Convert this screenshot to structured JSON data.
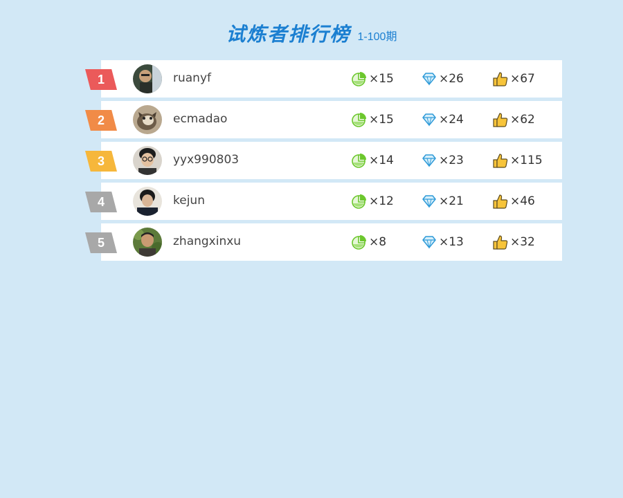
{
  "header": {
    "title": "试炼者排行榜",
    "subtitle": "1-100期"
  },
  "colors": {
    "background": "#d2e8f6",
    "accent": "#1b7fd1",
    "rank_colors": [
      "#eb5a5a",
      "#f18b47",
      "#f6b73b",
      "#a8a8a8",
      "#a8a8a8"
    ]
  },
  "leaderboard": [
    {
      "rank": "1",
      "username": "ruanyf",
      "pie": "×15",
      "diamond": "×26",
      "like": "×67"
    },
    {
      "rank": "2",
      "username": "ecmadao",
      "pie": "×15",
      "diamond": "×24",
      "like": "×62"
    },
    {
      "rank": "3",
      "username": "yyx990803",
      "pie": "×14",
      "diamond": "×23",
      "like": "×115"
    },
    {
      "rank": "4",
      "username": "kejun",
      "pie": "×12",
      "diamond": "×21",
      "like": "×46"
    },
    {
      "rank": "5",
      "username": "zhangxinxu",
      "pie": "×8",
      "diamond": "×13",
      "like": "×32"
    }
  ],
  "icons": {
    "pie": "pie-chart-icon",
    "diamond": "diamond-icon",
    "like": "thumbs-up-icon"
  }
}
